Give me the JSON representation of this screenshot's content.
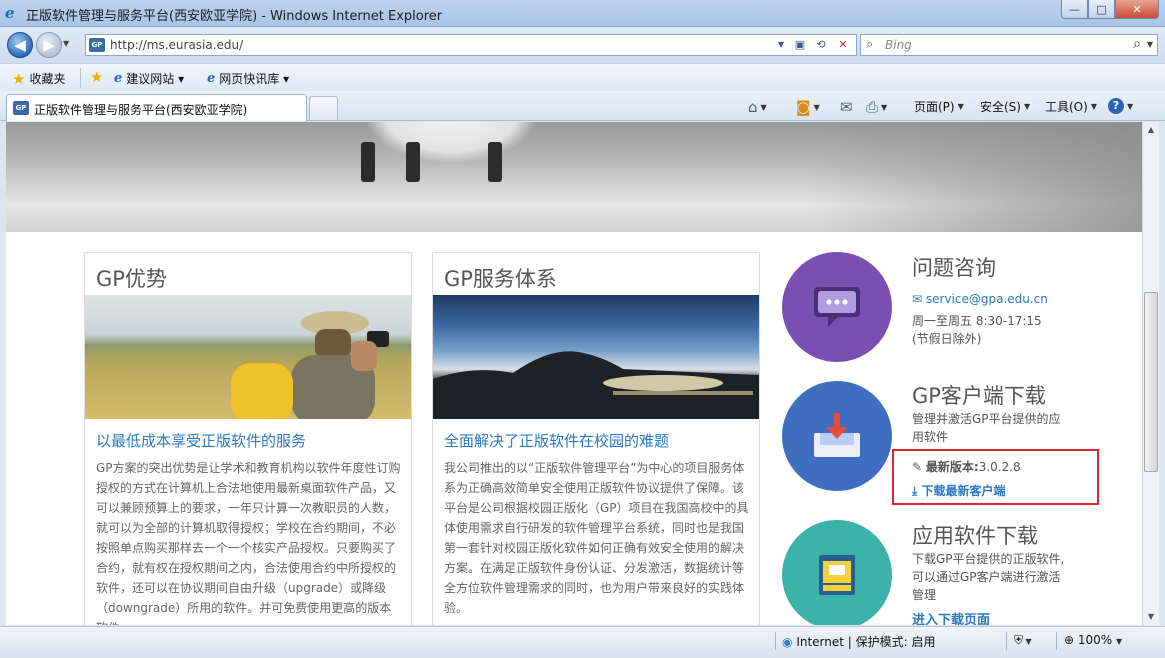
{
  "window": {
    "title": "正版软件管理与服务平台(西安欧亚学院) - Windows Internet Explorer",
    "buttons": {
      "minimize": "—",
      "maximize": "□",
      "close": "✕"
    }
  },
  "address": {
    "url": "http://ms.eurasia.edu/",
    "search_placeholder": "Bing"
  },
  "favorites": {
    "label": "收藏夹",
    "items": [
      "建议网站 ▾",
      "网页快讯库 ▾"
    ]
  },
  "tab": {
    "label": "正版软件管理与服务平台(西安欧亚学院)"
  },
  "commands": {
    "page": "页面(P)",
    "safety": "安全(S)",
    "tools": "工具(O)"
  },
  "cards": [
    {
      "title": "GP优势",
      "subtitle": "以最低成本享受正版软件的服务",
      "body": "GP方案的突出优势是让学术和教育机构以软件年度性订购授权的方式在计算机上合法地使用最新桌面软件产品，又可以兼顾预算上的要求，一年只计算一次教职员的人数，就可以为全部的计算机取得授权；学校在合约期间，不必按照单点购买那样去一个一个核实产品授权。只要购买了合约，就有权在授权期间之内，合法使用合约中所授权的软件，还可以在协议期间自由升级（upgrade）或降级（downgrade）所用的软件。并可免费使用更高的版本软件"
    },
    {
      "title": "GP服务体系",
      "subtitle": "全面解决了正版软件在校园的难题",
      "body": "我公司推出的以“正版软件管理平台”为中心的项目服务体系为正确高效简单安全使用正版软件协议提供了保障。该平台是公司根据校园正版化（GP）项目在我国高校中的具体使用需求自行研发的软件管理平台系统，同时也是我国第一套针对校园正版化软件如何正确有效安全使用的解决方案。在满足正版软件身份认证、分发激活，数据统计等全方位软件管理需求的同时，也为用户带来良好的实践体验。"
    }
  ],
  "consult": {
    "title": "问题咨询",
    "email": "service@gpa.edu.cn",
    "hours": "周一至周五 8:30-17:15",
    "note": "(节假日除外)"
  },
  "client": {
    "title": "GP客户端下载",
    "desc": "管理并激活GP平台提供的应用软件",
    "version_label": "最新版本:",
    "version": "3.0.2.8",
    "download": "下载最新客户端"
  },
  "apps": {
    "title": "应用软件下载",
    "desc": "下载GP平台提供的正版软件,可以通过GP客户端进行激活管理",
    "link": "进入下载页面"
  },
  "status": {
    "zone": "Internet | 保护模式: 启用",
    "zoom": "100%"
  },
  "colors": {
    "purple": "#7a4fb2",
    "blue": "#3f6ec0",
    "teal": "#3bb3a9",
    "link": "#2a79c1",
    "highlight": "#e0242b"
  }
}
